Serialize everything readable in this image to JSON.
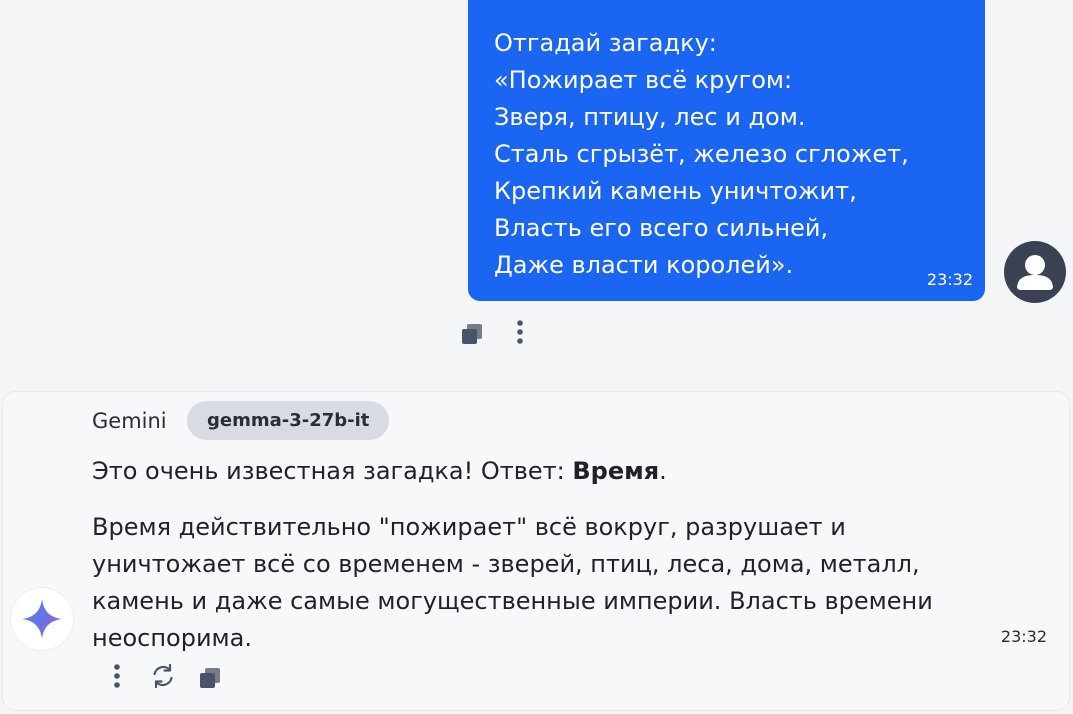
{
  "user_message": {
    "lines": [
      "Отгадай загадку:",
      "«Пожирает всё кругом:",
      "Зверя, птицу, лес и дом.",
      "Сталь сгрызёт, железо сгложет,",
      "Крепкий камень уничтожит,",
      "Власть его всего сильней,",
      "Даже власти королей»."
    ],
    "time": "23:32",
    "avatar_icon": "user-avatar-icon",
    "actions": [
      "copy-icon",
      "more-vertical-icon"
    ]
  },
  "assistant_message": {
    "name": "Gemini",
    "model": "gemma-3-27b-it",
    "intro_prefix": "Это очень известная загадка! Ответ: ",
    "intro_answer": "Время",
    "intro_suffix": ".",
    "body_lines": [
      "Время действительно \"пожирает\" всё вокруг, разрушает и",
      "уничтожает всё со временем - зверей, птиц, леса, дома, металл,",
      "камень и даже самые могущественные империи. Власть времени",
      "неоспорима."
    ],
    "time": "23:32",
    "avatar_icon": "gemini-sparkle-icon",
    "actions": [
      "more-vertical-icon",
      "regenerate-icon",
      "copy-icon"
    ]
  },
  "colors": {
    "user_bubble": "#1a66f2",
    "background": "#f4f5f7",
    "model_chip": "#d8dbe1",
    "icon": "#4a5468"
  }
}
